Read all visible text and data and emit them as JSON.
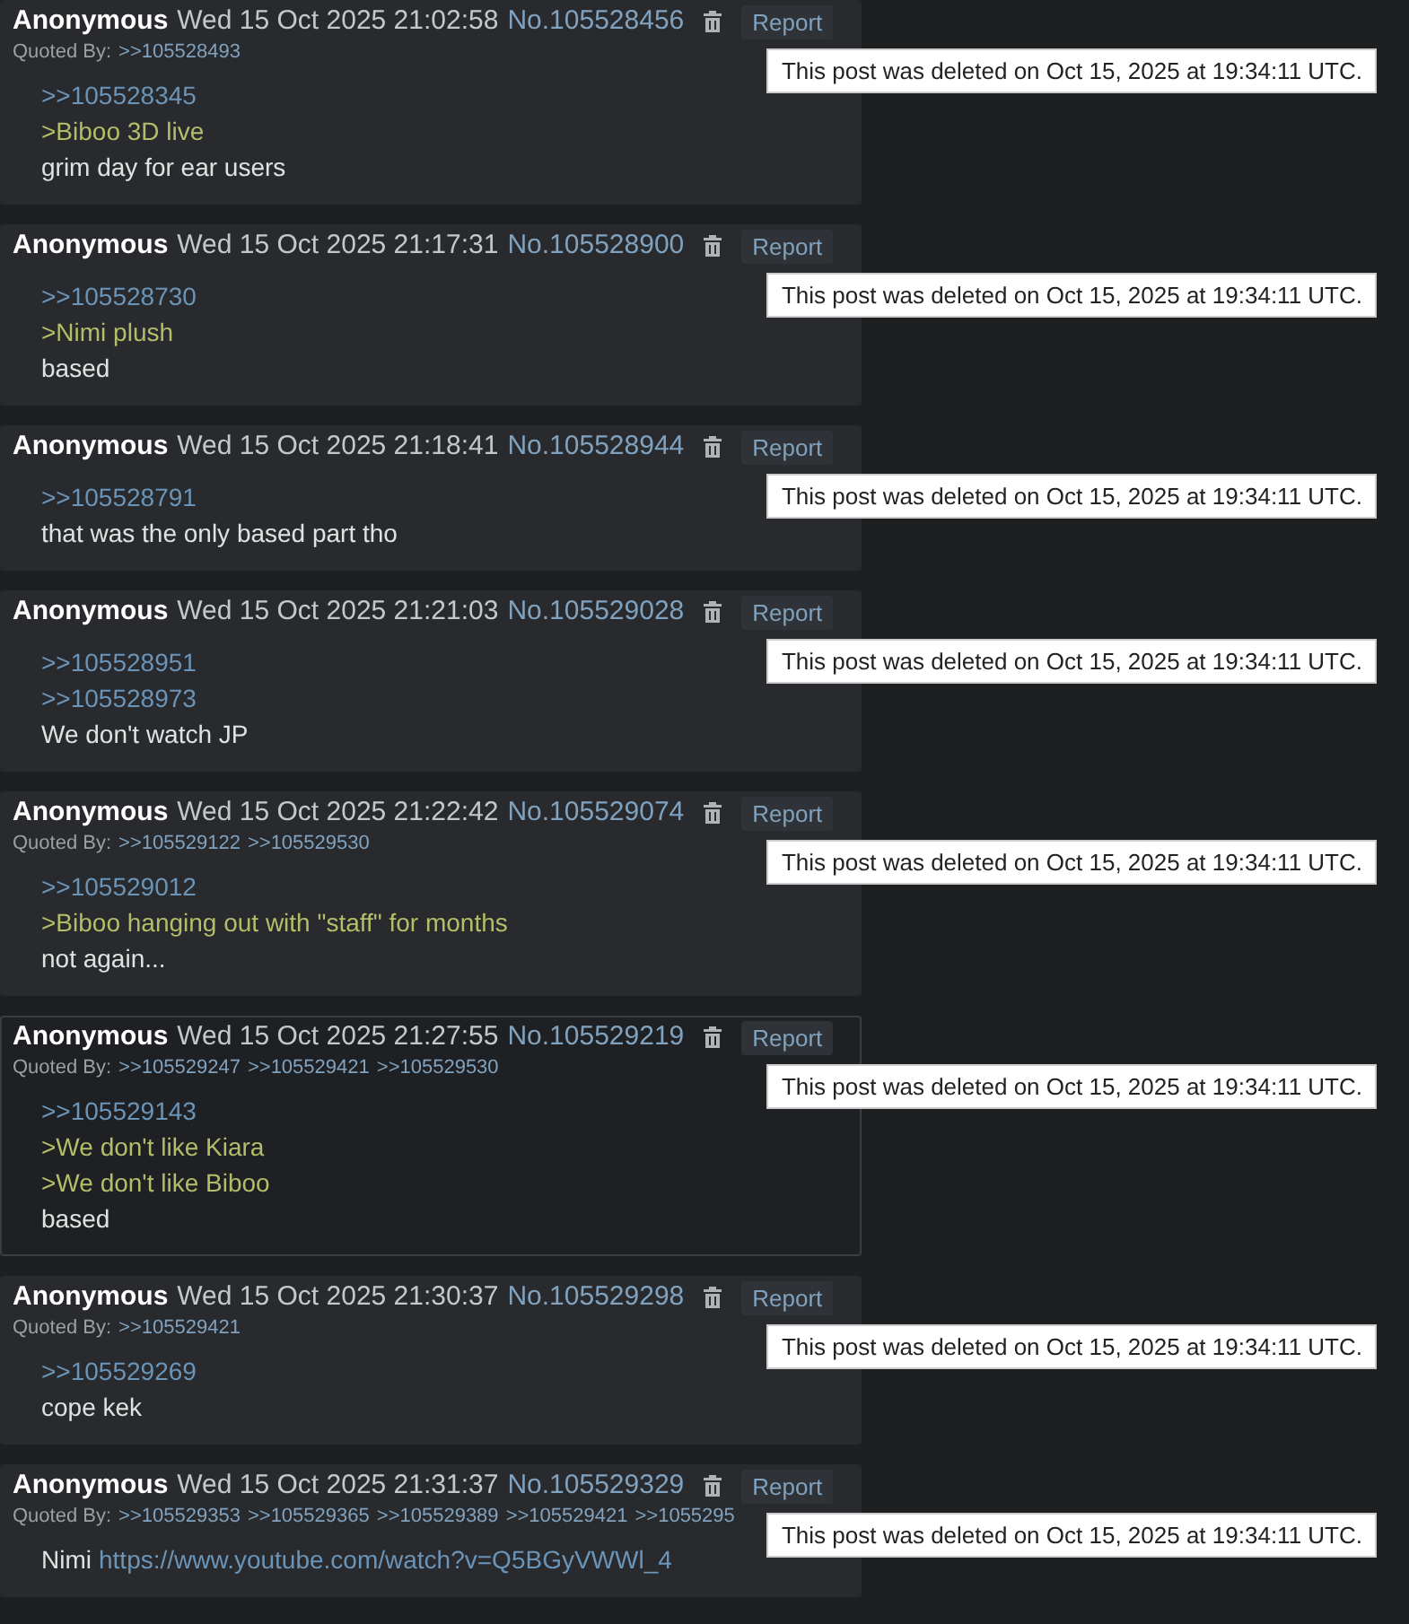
{
  "posts": [
    {
      "name": "Anonymous",
      "date": "Wed 15 Oct 2025 21:02:58",
      "number": "No.105528456",
      "report": "Report",
      "highlighted": false,
      "quoted_by_label": "Quoted By:",
      "quoted_by": [
        ">>105528493"
      ],
      "lines": [
        [
          {
            "kind": "quote",
            "text": ">>105528345"
          }
        ],
        [
          {
            "kind": "green",
            "text": ">Biboo 3D live"
          }
        ],
        [
          {
            "kind": "text",
            "text": "grim day for ear users"
          }
        ]
      ],
      "notice": "This post was deleted on Oct 15, 2025 at 19:34:11 UTC."
    },
    {
      "name": "Anonymous",
      "date": "Wed 15 Oct 2025 21:17:31",
      "number": "No.105528900",
      "report": "Report",
      "highlighted": false,
      "lines": [
        [
          {
            "kind": "quote",
            "text": ">>105528730"
          }
        ],
        [
          {
            "kind": "green",
            "text": ">Nimi plush"
          }
        ],
        [
          {
            "kind": "text",
            "text": "based"
          }
        ]
      ],
      "notice": "This post was deleted on Oct 15, 2025 at 19:34:11 UTC."
    },
    {
      "name": "Anonymous",
      "date": "Wed 15 Oct 2025 21:18:41",
      "number": "No.105528944",
      "report": "Report",
      "highlighted": false,
      "lines": [
        [
          {
            "kind": "quote",
            "text": ">>105528791"
          }
        ],
        [
          {
            "kind": "text",
            "text": "that was the only based part tho"
          }
        ]
      ],
      "notice": "This post was deleted on Oct 15, 2025 at 19:34:11 UTC."
    },
    {
      "name": "Anonymous",
      "date": "Wed 15 Oct 2025 21:21:03",
      "number": "No.105529028",
      "report": "Report",
      "highlighted": false,
      "lines": [
        [
          {
            "kind": "quote",
            "text": ">>105528951"
          }
        ],
        [
          {
            "kind": "quote",
            "text": ">>105528973"
          }
        ],
        [
          {
            "kind": "text",
            "text": "We don't watch JP"
          }
        ]
      ],
      "notice": "This post was deleted on Oct 15, 2025 at 19:34:11 UTC."
    },
    {
      "name": "Anonymous",
      "date": "Wed 15 Oct 2025 21:22:42",
      "number": "No.105529074",
      "report": "Report",
      "highlighted": false,
      "quoted_by_label": "Quoted By:",
      "quoted_by": [
        ">>105529122",
        ">>105529530"
      ],
      "lines": [
        [
          {
            "kind": "quote",
            "text": ">>105529012"
          }
        ],
        [
          {
            "kind": "green",
            "text": ">Biboo hanging out with \"staff\" for months"
          }
        ],
        [
          {
            "kind": "text",
            "text": "not again..."
          }
        ]
      ],
      "notice": "This post was deleted on Oct 15, 2025 at 19:34:11 UTC."
    },
    {
      "name": "Anonymous",
      "date": "Wed 15 Oct 2025 21:27:55",
      "number": "No.105529219",
      "report": "Report",
      "highlighted": true,
      "quoted_by_label": "Quoted By:",
      "quoted_by": [
        ">>105529247",
        ">>105529421",
        ">>105529530"
      ],
      "lines": [
        [
          {
            "kind": "quote",
            "text": ">>105529143"
          }
        ],
        [
          {
            "kind": "green",
            "text": ">We don't like Kiara"
          }
        ],
        [
          {
            "kind": "green",
            "text": ">We don't like Biboo"
          }
        ],
        [
          {
            "kind": "text",
            "text": "based"
          }
        ]
      ],
      "notice": "This post was deleted on Oct 15, 2025 at 19:34:11 UTC."
    },
    {
      "name": "Anonymous",
      "date": "Wed 15 Oct 2025 21:30:37",
      "number": "No.105529298",
      "report": "Report",
      "highlighted": false,
      "quoted_by_label": "Quoted By:",
      "quoted_by": [
        ">>105529421"
      ],
      "lines": [
        [
          {
            "kind": "quote",
            "text": ">>105529269"
          }
        ],
        [
          {
            "kind": "text",
            "text": "cope kek"
          }
        ]
      ],
      "notice": "This post was deleted on Oct 15, 2025 at 19:34:11 UTC."
    },
    {
      "name": "Anonymous",
      "date": "Wed 15 Oct 2025 21:31:37",
      "number": "No.105529329",
      "report": "Report",
      "highlighted": false,
      "quoted_by_label": "Quoted By:",
      "quoted_by": [
        ">>105529353",
        ">>105529365",
        ">>105529389",
        ">>105529421",
        ">>1055295"
      ],
      "lines": [
        [
          {
            "kind": "text",
            "text": "Nimi"
          },
          {
            "kind": "url",
            "text": "https://www.youtube.com/watch?v=Q5BGyVWWl_4"
          }
        ]
      ],
      "notice": "This post was deleted on Oct 15, 2025 at 19:34:11 UTC."
    }
  ]
}
